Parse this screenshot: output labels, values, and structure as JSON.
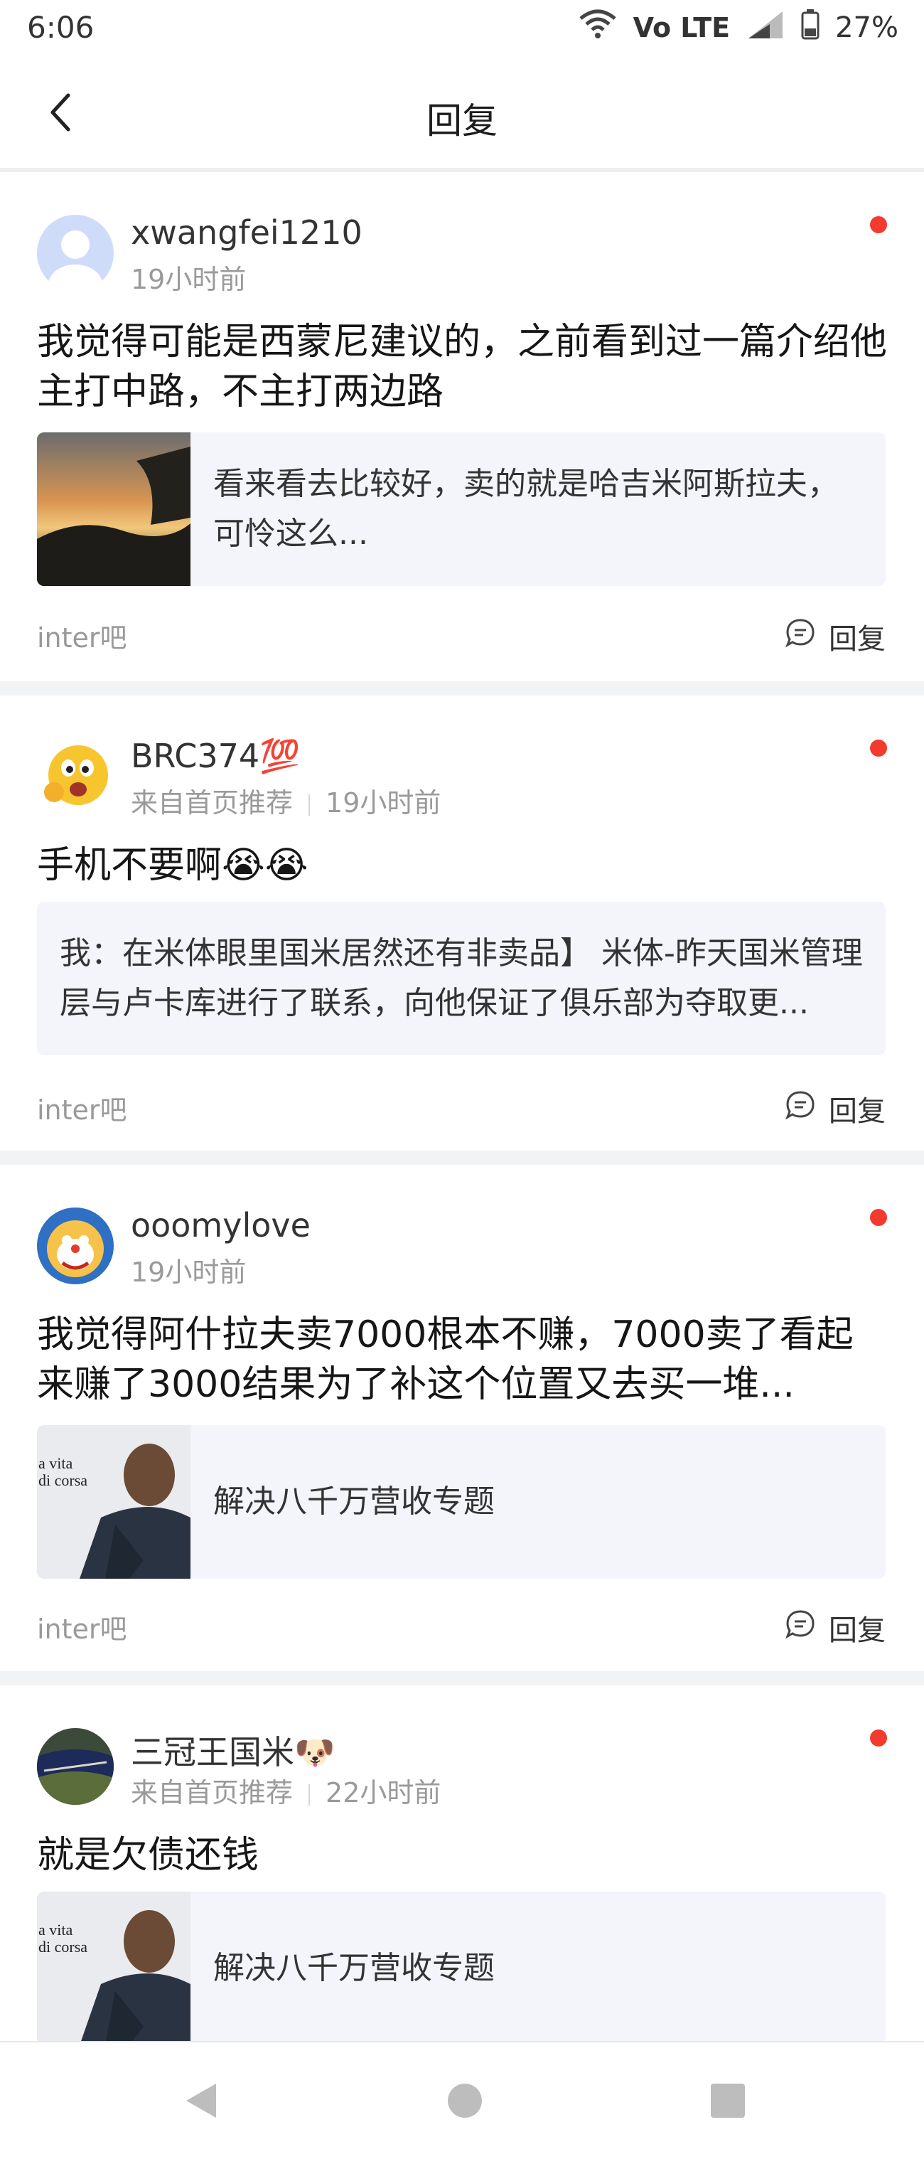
{
  "status_bar": {
    "time": "6:06",
    "network": "Vo LTE",
    "battery": "27%",
    "icons": [
      "wifi-icon",
      "volte-icon",
      "signal-icon",
      "battery-icon"
    ]
  },
  "header": {
    "title": "回复",
    "back_icon": "chevron-left-icon"
  },
  "posts": [
    {
      "username": "xwangfei1210",
      "source": "",
      "time": "19小时前",
      "content": "我觉得可能是西蒙尼建议的，之前看到过一篇介绍他主打中路，不主打两边路",
      "quote_text": "看来看去比较好，卖的就是哈吉米阿斯拉夫，可怜这么...",
      "quote_image": "sunset-photo",
      "tag": "inter吧",
      "reply_label": "回复",
      "unread": true
    },
    {
      "username": "BRC374💯",
      "source": "来自首页推荐",
      "time": "19小时前",
      "content": "手机不要啊😭😭",
      "quote_text": "我：在米体眼里国米居然还有非卖品】 米体-昨天国米管理层与卢卡库进行了联系，向他保证了俱乐部为夺取更...",
      "quote_image": "",
      "tag": "inter吧",
      "reply_label": "回复",
      "unread": true
    },
    {
      "username": "ooomylove",
      "source": "",
      "time": "19小时前",
      "content": "我觉得阿什拉夫卖7000根本不赚，7000卖了看起来赚了3000结果为了补这个位置又去买一堆...",
      "quote_text": "解决八千万营收专题",
      "quote_image": "player-photo",
      "tag": "inter吧",
      "reply_label": "回复",
      "unread": true
    },
    {
      "username": "三冠王国米🐶",
      "source": "来自首页推荐",
      "time": "22小时前",
      "content": "就是欠债还钱",
      "quote_text": "解决八千万营收专题",
      "quote_image": "player-photo",
      "tag": "",
      "reply_label": "",
      "unread": true
    }
  ],
  "thumb_text": {
    "line1": "a vita",
    "line2": "di corsa"
  },
  "nav_bar": {
    "buttons": [
      "back-triangle-icon",
      "home-circle-icon",
      "recents-square-icon"
    ]
  },
  "colors": {
    "accent_dot": "#f23a2e",
    "quote_bg": "#f4f5fb",
    "muted_text": "#9a9a9a"
  }
}
